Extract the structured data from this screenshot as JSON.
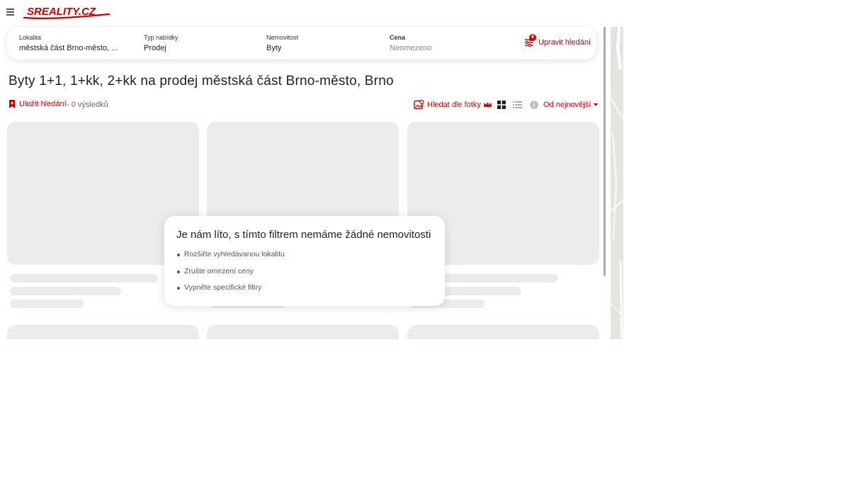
{
  "header": {
    "logo_text": "SREALITY.CZ",
    "logo_color": "#cc0000"
  },
  "search": {
    "fields": [
      {
        "label": "Lokalita",
        "value": "městská část Brno-město, ..."
      },
      {
        "label": "Typ nabídky",
        "value": "Prodej"
      },
      {
        "label": "Nemovitost",
        "value": "Byty"
      },
      {
        "label": "Cena",
        "value": "Neomezeno"
      }
    ],
    "edit_label": "Upravit hledání",
    "filter_count": "8"
  },
  "page": {
    "title": "Byty 1+1, 1+kk, 2+kk na prodej městská část Brno-město, Brno"
  },
  "toolbar": {
    "save_label": "Uložit hledání",
    "results": "- 0 výsledků",
    "photo_search_label": "Hledat dle fotky",
    "sort_label": "Od nejnovější"
  },
  "empty_state": {
    "title": "Je nám líto, s tímto filtrem nemáme žádné nemovitosti",
    "suggestions": [
      "Rozšiřte vyhledávanou lokalitu",
      "Zrušte omezení ceny",
      "Vypněte specifické filtry"
    ]
  },
  "colors": {
    "accent": "#cc0000",
    "skeleton": "#ebecec",
    "text": "#222222",
    "muted": "#888888"
  },
  "icons": [
    "menu-icon",
    "filter-icon",
    "bookmark-icon",
    "photo-search-icon",
    "crown-icon",
    "grid-view-icon",
    "list-view-icon",
    "info-icon",
    "caret-down-icon"
  ]
}
